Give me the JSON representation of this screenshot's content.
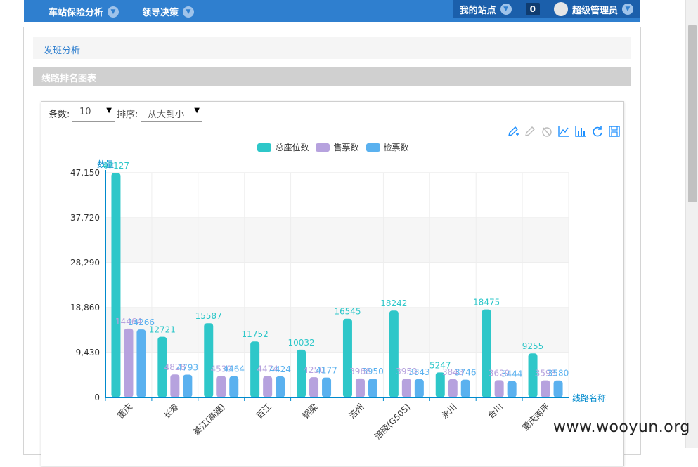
{
  "topnav": {
    "items": [
      {
        "label": "车站保险分析"
      },
      {
        "label": "领导决策"
      }
    ],
    "my_station": "我的站点",
    "badge_count": "0",
    "user": "超级管理员"
  },
  "breadcrumb": {
    "link": "发班分析"
  },
  "section": {
    "title": "线路排名图表"
  },
  "controls": {
    "count_label": "条数:",
    "count_value": "10",
    "sort_label": "排序:",
    "sort_value": "从大到小"
  },
  "toolbox_icons": [
    "mark-icon",
    "erase-mark-icon",
    "clear-icon",
    "line-chart-icon",
    "bar-chart-icon",
    "restore-icon",
    "save-image-icon"
  ],
  "colors": {
    "total": "#2ec7c9",
    "sold": "#b6a2de",
    "checked": "#5ab1ef",
    "axis": "#008acd"
  },
  "chart_data": {
    "type": "bar",
    "ylabel": "数量",
    "xlabel": "线路名称",
    "ylim": [
      0,
      47150
    ],
    "yticks": [
      "0",
      "9,430",
      "18,860",
      "28,290",
      "37,720",
      "47,150"
    ],
    "ytick_values": [
      0,
      9430,
      18860,
      28290,
      37720,
      47150
    ],
    "categories": [
      "重庆",
      "长寿",
      "綦江(高速)",
      "百江",
      "铜梁",
      "涪州",
      "涪陵(G50S)",
      "永川",
      "合川",
      "重庆南坪"
    ],
    "series": [
      {
        "name": "总座位数",
        "values": [
          47127,
          12721,
          15587,
          11752,
          10032,
          16545,
          18242,
          5247,
          18475,
          9255
        ],
        "labels": [
          "47127",
          "12721",
          "15587",
          "11752",
          "10032",
          "16545",
          "18242",
          "5247",
          "18475",
          "9255"
        ]
      },
      {
        "name": "售票数",
        "values": [
          14464,
          4828,
          4530,
          4474,
          4250,
          3988,
          3950,
          3843,
          3629,
          3593
        ],
        "labels": [
          "14464",
          "4828",
          "4530",
          "4474",
          "4250",
          "3988",
          "3950",
          "3843",
          "3629",
          "3593"
        ]
      },
      {
        "name": "检票数",
        "values": [
          14266,
          4793,
          4464,
          4424,
          4177,
          3950,
          3843,
          3746,
          3444,
          3580
        ],
        "labels": [
          "14266",
          "4793",
          "4464",
          "4424",
          "4177",
          "3950",
          "3843",
          "3746",
          "3444",
          "3580"
        ]
      }
    ],
    "legend_position": "top-center",
    "grid": true
  },
  "watermark": "www.wooyun.org"
}
